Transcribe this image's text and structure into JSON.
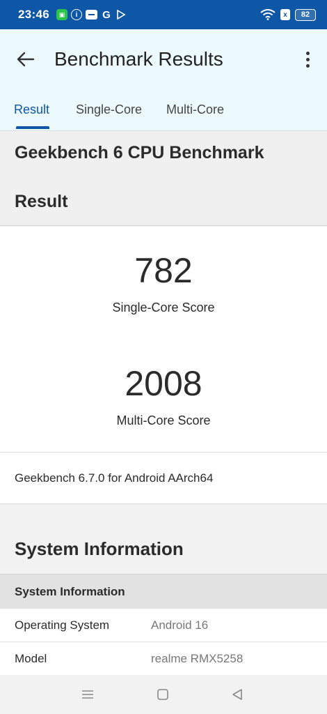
{
  "status_bar": {
    "time": "23:46",
    "battery": "82",
    "g_letter": "G",
    "sim_letter": "x"
  },
  "header": {
    "title": "Benchmark Results"
  },
  "tabs": [
    {
      "label": "Result",
      "active": true
    },
    {
      "label": "Single-Core",
      "active": false
    },
    {
      "label": "Multi-Core",
      "active": false
    }
  ],
  "section": {
    "title": "Geekbench 6 CPU Benchmark",
    "subtitle": "Result"
  },
  "scores": {
    "single": {
      "value": "782",
      "label": "Single-Core Score"
    },
    "multi": {
      "value": "2008",
      "label": "Multi-Core Score"
    }
  },
  "version_text": "Geekbench 6.7.0 for Android AArch64",
  "system_info": {
    "title": "System Information",
    "table_header": "System Information",
    "rows": [
      {
        "key": "Operating System",
        "value": "Android 16"
      },
      {
        "key": "Model",
        "value": "realme RMX5258"
      }
    ]
  },
  "colors": {
    "accent": "#0d57a6",
    "header_bg": "#edfafd"
  }
}
